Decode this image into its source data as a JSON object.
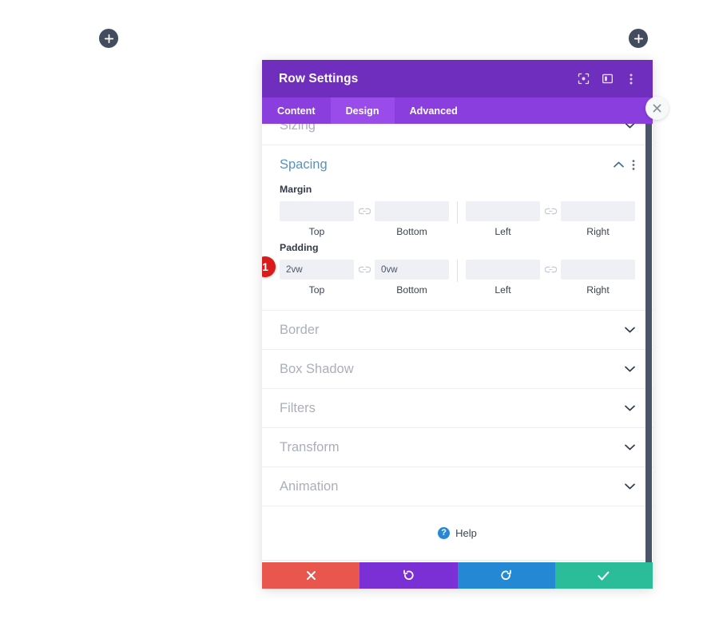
{
  "builder": {
    "add_left_label": "+",
    "add_right_label": "+",
    "add_icon": "plus-icon",
    "close_icon": "close-circle-icon"
  },
  "modal": {
    "title": "Row Settings",
    "header_icons": [
      {
        "name": "focus-icon",
        "label": "Focus"
      },
      {
        "name": "layout-split-icon",
        "label": "Layout"
      },
      {
        "name": "more-vertical-icon",
        "label": "More options"
      }
    ],
    "tabs": [
      {
        "label": "Content",
        "active": false
      },
      {
        "label": "Design",
        "active": true
      },
      {
        "label": "Advanced",
        "active": false
      }
    ],
    "sections": [
      {
        "title": "Sizing",
        "open": false,
        "state": "partially-scrolled"
      },
      {
        "title": "Spacing",
        "open": true
      },
      {
        "title": "Border",
        "open": false
      },
      {
        "title": "Box Shadow",
        "open": false
      },
      {
        "title": "Filters",
        "open": false
      },
      {
        "title": "Transform",
        "open": false
      },
      {
        "title": "Animation",
        "open": false
      }
    ],
    "spacing": {
      "heading": "Spacing",
      "link_icon": "broken-link-icon",
      "collapse_icon": "chevron-up-icon",
      "menu_icon": "more-vertical-icon",
      "margin": {
        "label": "Margin",
        "fields": [
          {
            "label": "Top",
            "value": "",
            "placeholder": ""
          },
          {
            "label": "Bottom",
            "value": "",
            "placeholder": ""
          },
          {
            "label": "Left",
            "value": "",
            "placeholder": ""
          },
          {
            "label": "Right",
            "value": "",
            "placeholder": ""
          }
        ]
      },
      "padding": {
        "label": "Padding",
        "badge": "1",
        "fields": [
          {
            "label": "Top",
            "value": "2vw",
            "placeholder": ""
          },
          {
            "label": "Bottom",
            "value": "0vw",
            "placeholder": ""
          },
          {
            "label": "Left",
            "value": "",
            "placeholder": ""
          },
          {
            "label": "Right",
            "value": "",
            "placeholder": ""
          }
        ]
      }
    },
    "help": {
      "label": "Help",
      "icon": "question-mark-icon"
    },
    "footer_buttons": [
      {
        "name": "cancel-button",
        "icon": "close-x-icon",
        "color": "#e9564e"
      },
      {
        "name": "undo-button",
        "icon": "undo-arrow-icon",
        "color": "#7b30d6"
      },
      {
        "name": "redo-button",
        "icon": "redo-arrow-icon",
        "color": "#2588d4"
      },
      {
        "name": "save-button",
        "icon": "checkmark-icon",
        "color": "#2bbd9a"
      }
    ]
  },
  "colors": {
    "header_purple": "#6f2ebd",
    "tab_purple": "#8b3ede",
    "tab_active_purple": "#9a4ceb",
    "badge_red": "#d91b1b",
    "scrollbar": "#4a5568",
    "section_heading_active": "#5b92b8"
  }
}
